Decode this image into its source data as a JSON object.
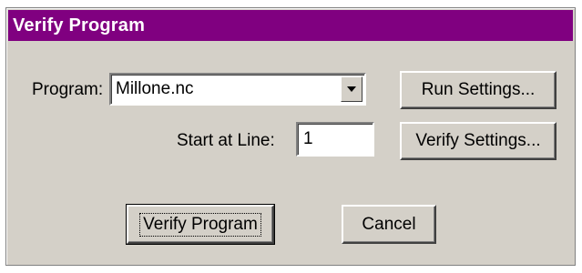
{
  "dialog": {
    "title": "Verify Program"
  },
  "program": {
    "label": "Program:",
    "value": "Millone.nc",
    "dropdown_icon": "chevron-down-icon"
  },
  "start_line": {
    "label": "Start at Line:",
    "value": "1"
  },
  "buttons": {
    "run_settings": "Run Settings...",
    "verify_settings": "Verify Settings...",
    "verify_program": "Verify Program",
    "cancel": "Cancel"
  },
  "colors": {
    "titlebar": "#800080",
    "title_text": "#ffffff",
    "face": "#d4d0c8"
  }
}
